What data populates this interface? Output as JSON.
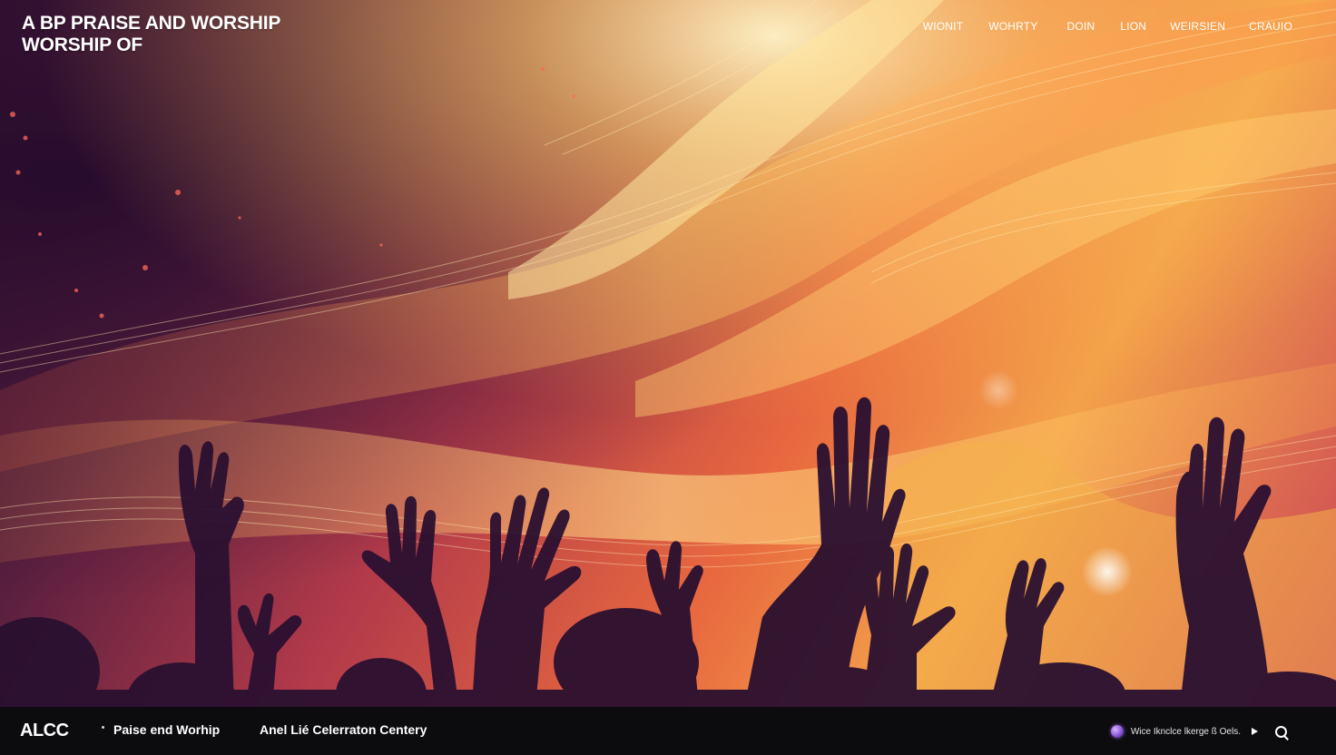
{
  "header": {
    "title_line1": "A BP PRAISE AND WORSHIP",
    "title_line2": "WORSHIP OF"
  },
  "nav": {
    "items": [
      "WIONIT",
      "WOHRTY",
      "DOIN",
      "LION",
      "WEIRSIEN",
      "CRAUIO"
    ]
  },
  "hero": {
    "image_description_icon": "worship-hands-light-waves"
  },
  "footer": {
    "brand": "ALCC",
    "link1": "Paise end Worhip",
    "link2": "Anel Lié Celerraton Centery",
    "now_playing_text": "Wice Iknclce lkerge ß Oels.",
    "play_icon": "play-icon",
    "search_icon": "search-icon"
  },
  "colors": {
    "bar_background": "#0c0b0e",
    "accent_orange": "#f3a24a",
    "accent_magenta": "#b23a4a",
    "orb_purple": "#8b55d8"
  }
}
